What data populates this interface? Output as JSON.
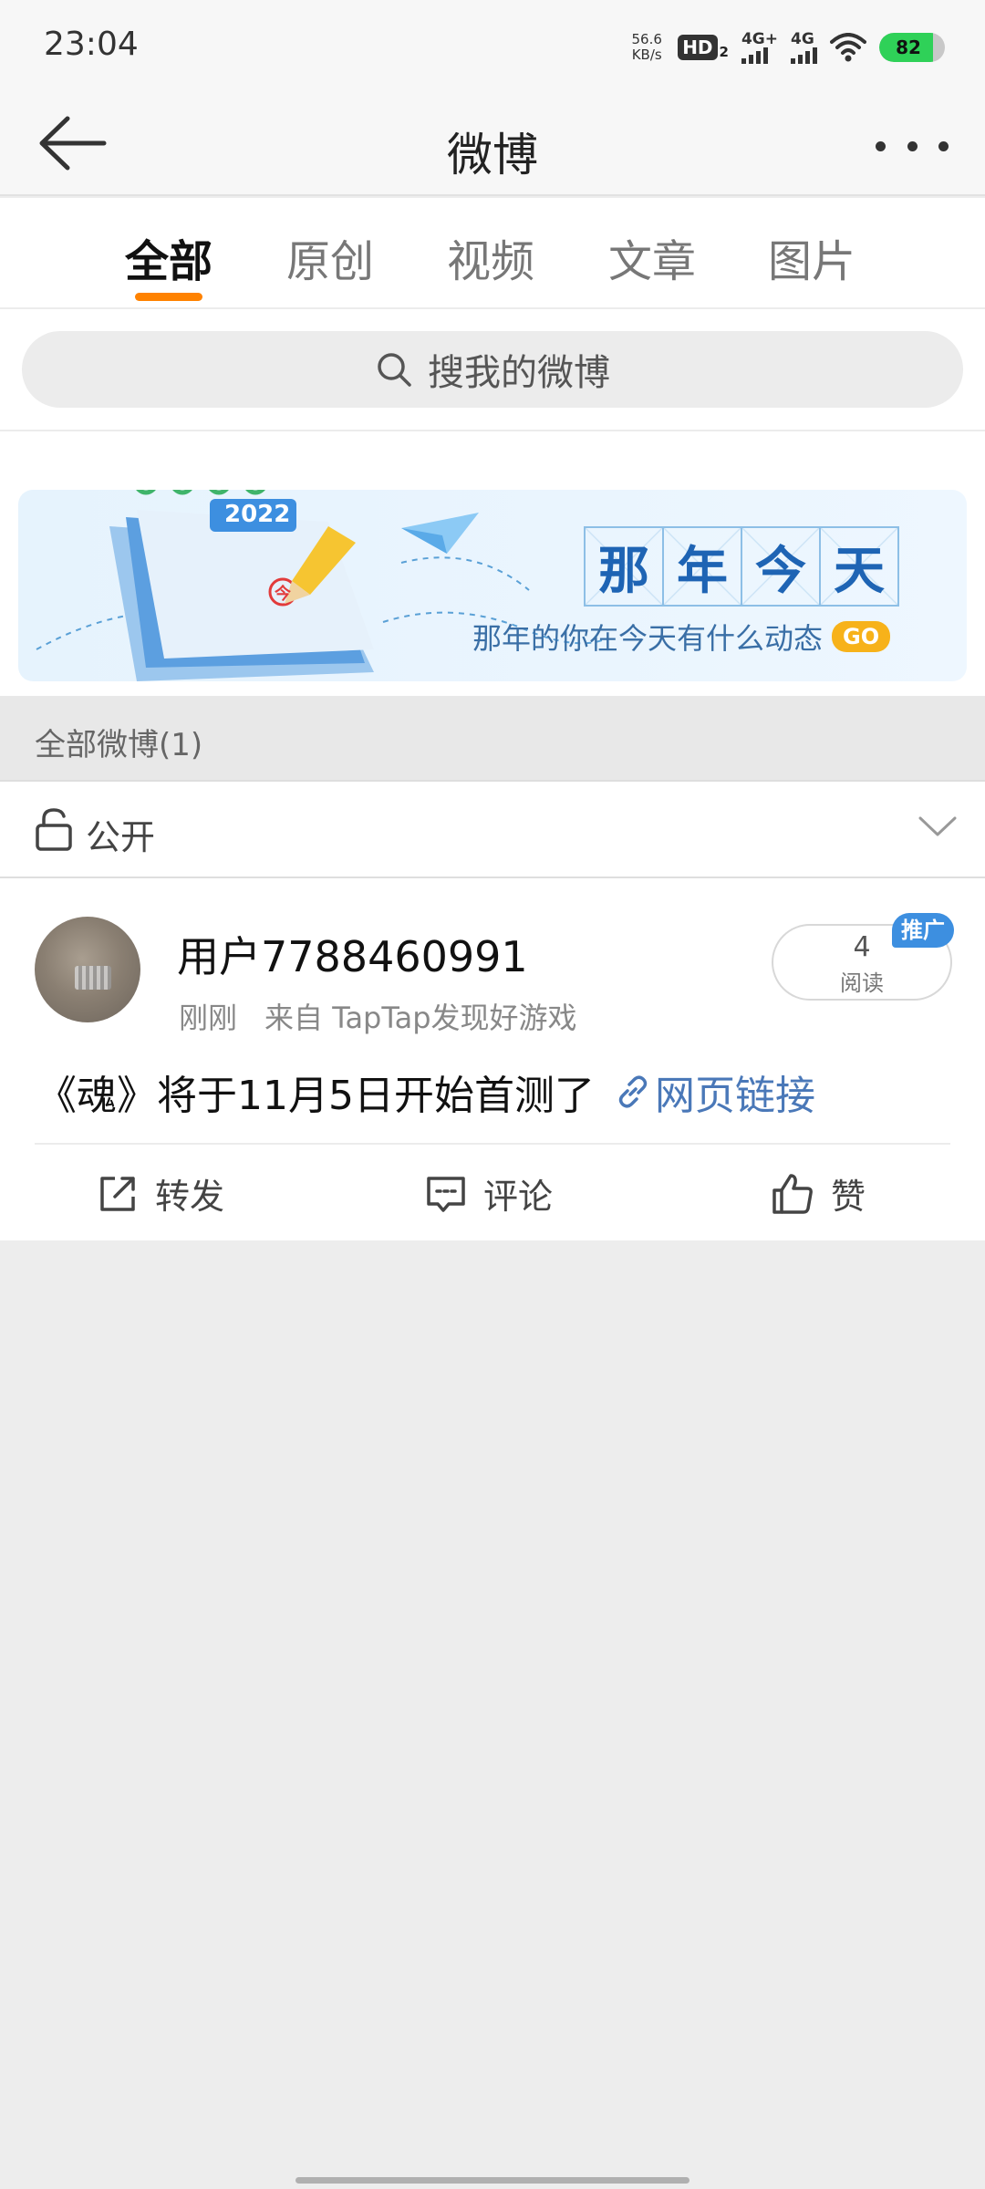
{
  "status_bar": {
    "time": "23:04",
    "net_speed_value": "56.6",
    "net_speed_unit": "KB/s",
    "hd_label": "HD",
    "hd_sub": "2",
    "signal1_label": "4G+",
    "signal2_label": "4G",
    "battery_level": "82"
  },
  "header": {
    "title": "微博"
  },
  "tabs": [
    {
      "label": "全部",
      "active": true
    },
    {
      "label": "原创",
      "active": false
    },
    {
      "label": "视频",
      "active": false
    },
    {
      "label": "文章",
      "active": false
    },
    {
      "label": "图片",
      "active": false
    }
  ],
  "search": {
    "placeholder": "搜我的微博"
  },
  "banner": {
    "chars": [
      "那",
      "年",
      "今",
      "天"
    ],
    "subtitle": "那年的你在今天有什么动态",
    "go_label": "GO",
    "calendar_year": "2022",
    "calendar_mark": "今"
  },
  "section": {
    "title": "全部微博(1)"
  },
  "filter": {
    "label": "公开"
  },
  "post": {
    "username": "用户7788460991",
    "time": "刚刚",
    "source": "来自 TapTap发现好游戏",
    "read_count": "4",
    "read_label": "阅读",
    "promo_badge": "推广",
    "content": "《魂》将于11月5日开始首测了",
    "link_text": "网页链接",
    "actions": {
      "repost": "转发",
      "comment": "评论",
      "like": "赞"
    }
  },
  "colors": {
    "accent": "#ff8200",
    "link": "#4a78b8",
    "promo": "#3d8fe0",
    "battery": "#2fd158"
  }
}
